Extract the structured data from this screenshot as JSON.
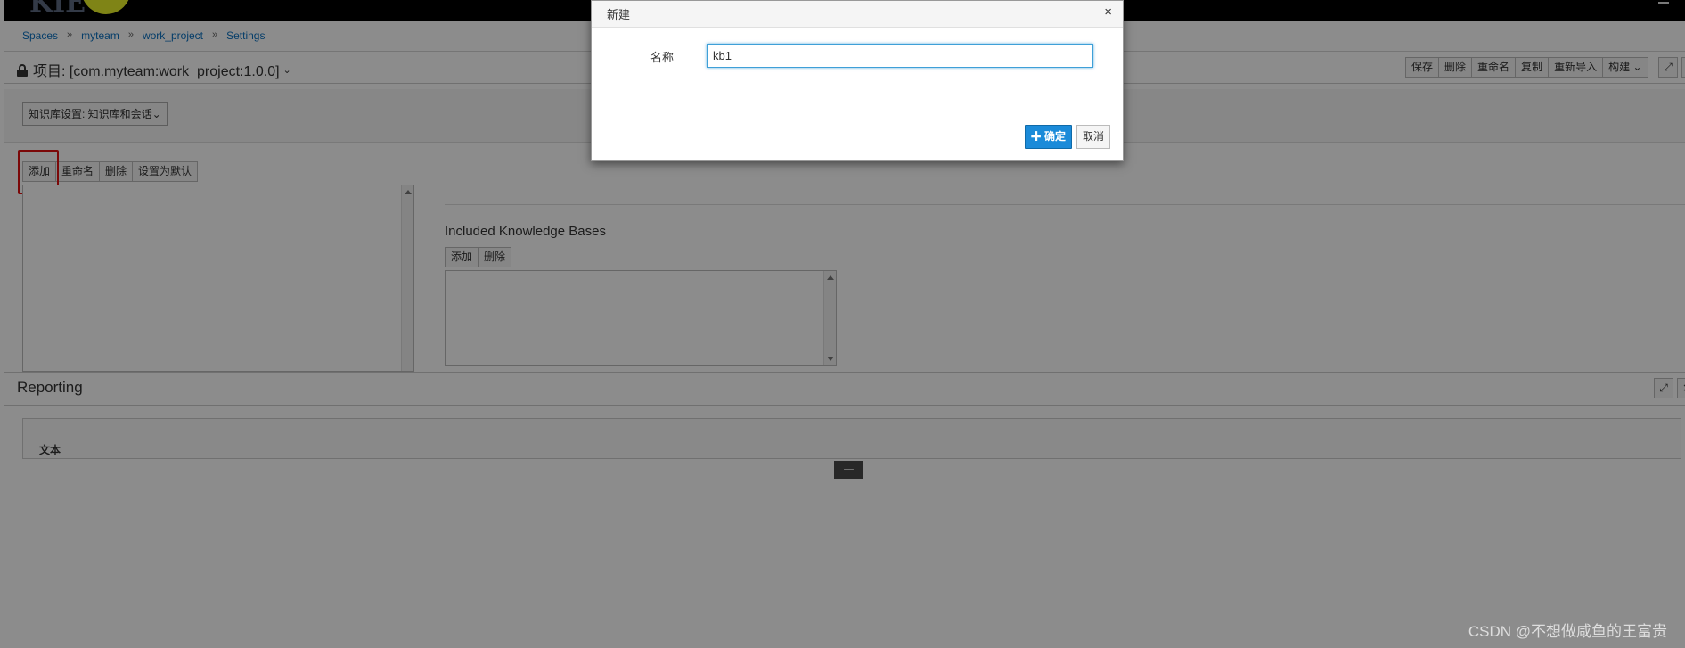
{
  "app": {
    "logo": "KIE"
  },
  "breadcrumb": [
    "Spaces",
    "myteam",
    "work_project",
    "Settings"
  ],
  "project": {
    "title": "项目: [com.myteam:work_project:1.0.0]"
  },
  "toolbar": {
    "buttons": [
      "保存",
      "删除",
      "重命名",
      "复制",
      "重新导入",
      "构建"
    ],
    "expand_icon": "⤢",
    "close_icon": "×"
  },
  "kbase": {
    "dropdown_label": "知识库设置: 知识库和会话",
    "list_actions": [
      "添加",
      "重命名",
      "删除",
      "设置为默认"
    ],
    "included_title": "Included Knowledge Bases",
    "included_actions": [
      "添加",
      "删除"
    ]
  },
  "reporting": {
    "title": "Reporting",
    "column_header": "文本",
    "collapse_symbol": "—"
  },
  "modal": {
    "title": "新建",
    "close": "×",
    "name_label": "名称",
    "name_value": "kb1",
    "ok_label": "✚ 确定",
    "cancel_label": "取消"
  },
  "watermark": "CSDN @不想做咸鱼的王富贵"
}
